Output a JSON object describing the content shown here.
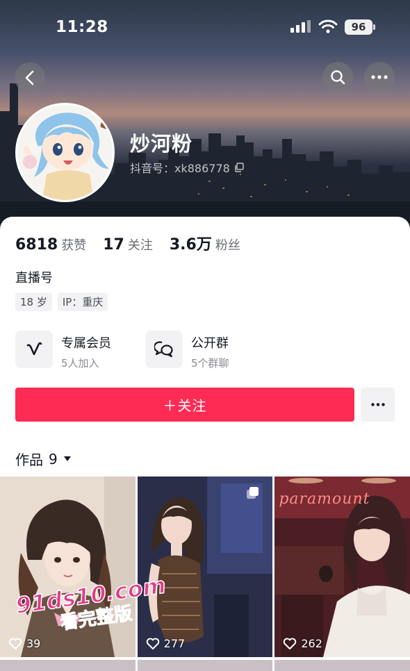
{
  "status_bar": {
    "time": "11:28",
    "battery": "96"
  },
  "header": {
    "nickname": "炒河粉",
    "douyin_id": "抖音号：xk886778"
  },
  "stats": [
    {
      "value": "6818",
      "label": "获赞"
    },
    {
      "value": "17",
      "label": "关注"
    },
    {
      "value": "3.6万",
      "label": "粉丝"
    }
  ],
  "profile": {
    "live_label": "直播号",
    "tags": [
      "18 岁",
      "IP：重庆"
    ]
  },
  "entries": {
    "member": {
      "title": "专属会员",
      "subtitle": "5人加入",
      "icon": "membership-v-icon"
    },
    "group": {
      "title": "公开群",
      "subtitle": "5个群聊",
      "icon": "chat-bubbles-icon"
    }
  },
  "actions": {
    "follow_label": "＋关注"
  },
  "works": {
    "tab_label": "作品",
    "count": "9"
  },
  "grid": [
    {
      "likes": "39"
    },
    {
      "likes": "277",
      "multi": true
    },
    {
      "likes": "262",
      "sign_text": "paramount"
    }
  ],
  "watermark": {
    "url": "91ds10.com",
    "text": "看完整版"
  },
  "colors": {
    "follow": "#fe2c55",
    "muted": "#6b6d75",
    "chip_bg": "#f2f2f4"
  }
}
